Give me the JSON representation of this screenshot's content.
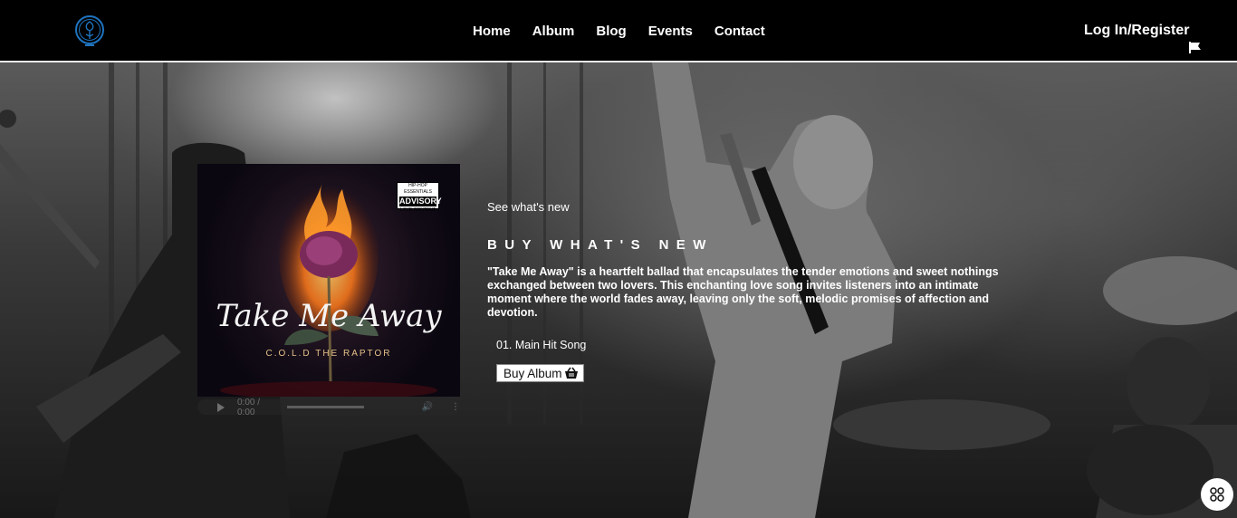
{
  "nav": {
    "logo_icon": "rose-emblem-icon",
    "items": [
      {
        "label": "Home"
      },
      {
        "label": "Album"
      },
      {
        "label": "Blog"
      },
      {
        "label": "Events"
      },
      {
        "label": "Contact"
      }
    ],
    "login_label": "Log In/Register",
    "language_icon": "flag-icon"
  },
  "album": {
    "cover_title": "Take Me Away",
    "cover_artist": "C.O.L.D THE RAPTOR",
    "advisory_top": "HIP-HOP ESSENTIALS",
    "advisory_main": "ADVISORY",
    "advisory_bottom": "LOVE CONTENT",
    "player": {
      "time": "0:00 / 0:00"
    }
  },
  "content": {
    "kicker": "See what's new",
    "headline": "BUY WHAT'S NEW",
    "description": "\"Take Me Away\" is a heartfelt ballad that encapsulates the tender emotions and sweet nothings exchanged between two lovers. This enchanting love song invites listeners into an intimate moment where the world fades away, leaving only the soft, melodic promises of affection and devotion.",
    "track": "01. Main Hit Song",
    "buy_label": "Buy Album",
    "buy_icon": "basket-icon"
  },
  "widget": {
    "icon": "app-grid-icon"
  },
  "colors": {
    "topbar": "#000000",
    "logo": "#1e73be"
  }
}
